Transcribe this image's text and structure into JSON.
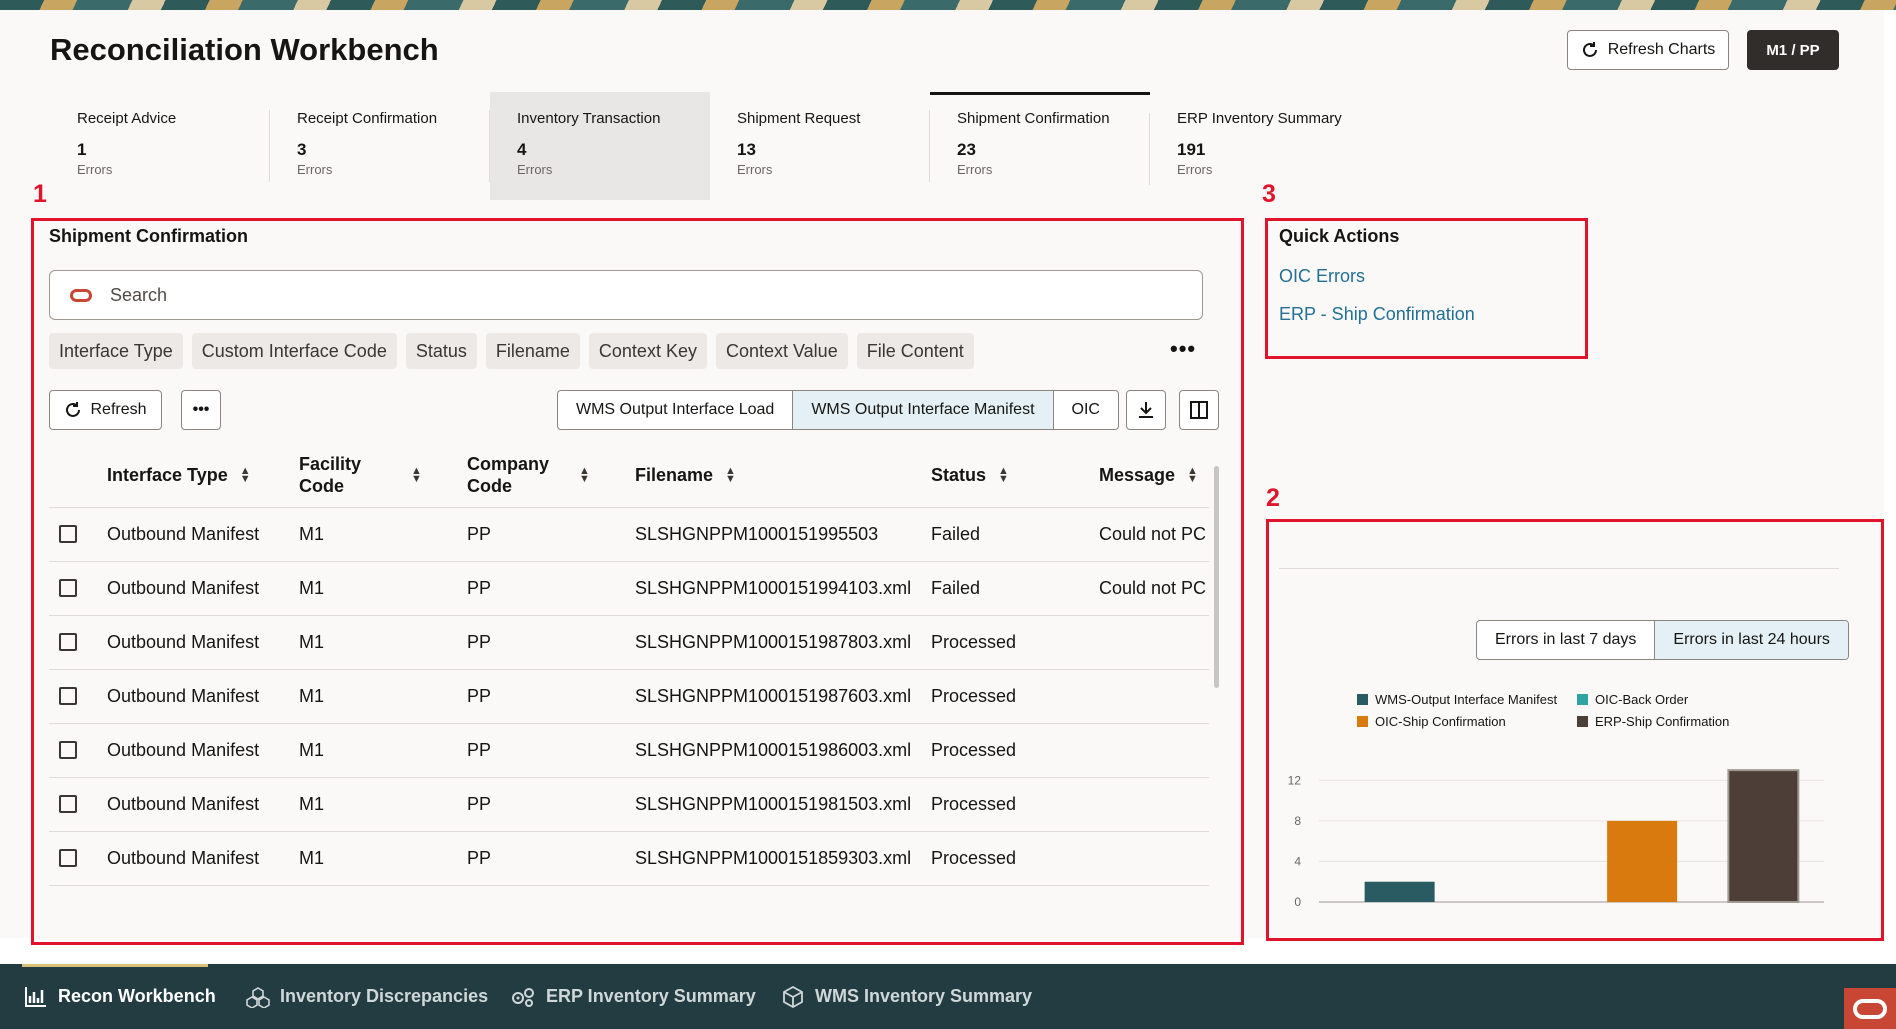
{
  "header": {
    "title": "Reconciliation Workbench",
    "refresh_charts_label": "Refresh Charts",
    "facility_label": "M1 / PP"
  },
  "summary_tabs": [
    {
      "label": "Receipt Advice",
      "count": "1",
      "sub": "Errors"
    },
    {
      "label": "Receipt Confirmation",
      "count": "3",
      "sub": "Errors"
    },
    {
      "label": "Inventory Transaction",
      "count": "4",
      "sub": "Errors"
    },
    {
      "label": "Shipment Request",
      "count": "13",
      "sub": "Errors"
    },
    {
      "label": "Shipment Confirmation",
      "count": "23",
      "sub": "Errors"
    },
    {
      "label": "ERP Inventory Summary",
      "count": "191",
      "sub": "Errors"
    }
  ],
  "annotations": {
    "n1": "1",
    "n2": "2",
    "n3": "3"
  },
  "panel": {
    "title": "Shipment Confirmation",
    "search_placeholder": "Search",
    "filter_chips": [
      "Interface Type",
      "Custom Interface Code",
      "Status",
      "Filename",
      "Context Key",
      "Context Value",
      "File Content"
    ],
    "more_label": "•••",
    "refresh_label": "Refresh",
    "actions_more_label": "•••",
    "segments": [
      "WMS Output Interface Load",
      "WMS Output Interface Manifest",
      "OIC"
    ],
    "selected_segment": "WMS Output Interface Manifest",
    "columns": [
      "Interface Type",
      "Facility Code",
      "Company Code",
      "Filename",
      "Status",
      "Message"
    ],
    "rows": [
      {
        "interface_type": "Outbound Manifest",
        "facility": "M1",
        "company": "PP",
        "filename": "SLSHGNPPM1000151995503",
        "status": "Failed",
        "message": "Could not PC"
      },
      {
        "interface_type": "Outbound Manifest",
        "facility": "M1",
        "company": "PP",
        "filename": "SLSHGNPPM1000151994103.xml",
        "status": "Failed",
        "message": "Could not PC"
      },
      {
        "interface_type": "Outbound Manifest",
        "facility": "M1",
        "company": "PP",
        "filename": "SLSHGNPPM1000151987803.xml",
        "status": "Processed",
        "message": ""
      },
      {
        "interface_type": "Outbound Manifest",
        "facility": "M1",
        "company": "PP",
        "filename": "SLSHGNPPM1000151987603.xml",
        "status": "Processed",
        "message": ""
      },
      {
        "interface_type": "Outbound Manifest",
        "facility": "M1",
        "company": "PP",
        "filename": "SLSHGNPPM1000151986003.xml",
        "status": "Processed",
        "message": ""
      },
      {
        "interface_type": "Outbound Manifest",
        "facility": "M1",
        "company": "PP",
        "filename": "SLSHGNPPM1000151981503.xml",
        "status": "Processed",
        "message": ""
      },
      {
        "interface_type": "Outbound Manifest",
        "facility": "M1",
        "company": "PP",
        "filename": "SLSHGNPPM1000151859303.xml",
        "status": "Processed",
        "message": ""
      }
    ]
  },
  "quick_actions": {
    "title": "Quick Actions",
    "links": [
      "OIC Errors",
      "ERP - Ship Confirmation"
    ]
  },
  "chart_controls": {
    "options": [
      "Errors in last 7 days",
      "Errors in last 24 hours"
    ],
    "selected": "Errors in last 24 hours"
  },
  "chart_data": {
    "type": "bar",
    "title": "",
    "xlabel": "",
    "ylabel": "",
    "ylim": [
      0,
      14
    ],
    "yticks": [
      0,
      4,
      8,
      12
    ],
    "grid": true,
    "legend_position": "top",
    "series": [
      {
        "name": "WMS-Output Interface Manifest",
        "color": "#2a5b63",
        "value": 2
      },
      {
        "name": "OIC-Back Order",
        "color": "#2ea5a3",
        "value": 0
      },
      {
        "name": "OIC-Ship Confirmation",
        "color": "#d97a0f",
        "value": 8
      },
      {
        "name": "ERP-Ship Confirmation",
        "color": "#4d3f38",
        "value": 13
      }
    ]
  },
  "bottom_nav": [
    {
      "label": "Recon Workbench",
      "icon": "chart-icon",
      "active": true
    },
    {
      "label": "Inventory Discrepancies",
      "icon": "cubes-icon",
      "active": false
    },
    {
      "label": "ERP Inventory Summary",
      "icon": "gears-icon",
      "active": false
    },
    {
      "label": "WMS Inventory Summary",
      "icon": "box-icon",
      "active": false
    }
  ]
}
